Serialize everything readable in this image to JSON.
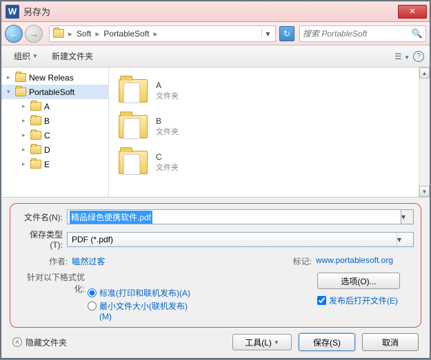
{
  "title": "另存为",
  "breadcrumb": {
    "seg1": "Soft",
    "seg2": "PortableSoft"
  },
  "search_placeholder": "搜索 PortableSoft",
  "toolbar": {
    "organize": "组织",
    "new_folder": "新建文件夹"
  },
  "tree": {
    "items": [
      {
        "label": "New Releas"
      },
      {
        "label": "PortableSoft"
      },
      {
        "label": "A"
      },
      {
        "label": "B"
      },
      {
        "label": "C"
      },
      {
        "label": "D"
      },
      {
        "label": "E"
      }
    ]
  },
  "files": {
    "type_label": "文件夹",
    "items": [
      {
        "name": "A"
      },
      {
        "name": "B"
      },
      {
        "name": "C"
      }
    ]
  },
  "form": {
    "filename_label": "文件名(N):",
    "filename_value": "精品绿色便携软件.pdf",
    "filetype_label": "保存类型(T):",
    "filetype_value": "PDF (*.pdf)",
    "author_label": "作者:",
    "author_value": "瞌然过客",
    "tag_label": "标记:",
    "tag_value": "www.portablesoft.org"
  },
  "optimize": {
    "title": "针对以下格式优化:",
    "option1": "标准(打印和联机发布)(A)",
    "option2": "最小文件大小(联机发布)(M)"
  },
  "options_btn": "选项(O)...",
  "open_after": "发布后打开文件(E)",
  "footer": {
    "hide_folders": "隐藏文件夹",
    "tools": "工具(L)",
    "save": "保存(S)",
    "cancel": "取消"
  }
}
